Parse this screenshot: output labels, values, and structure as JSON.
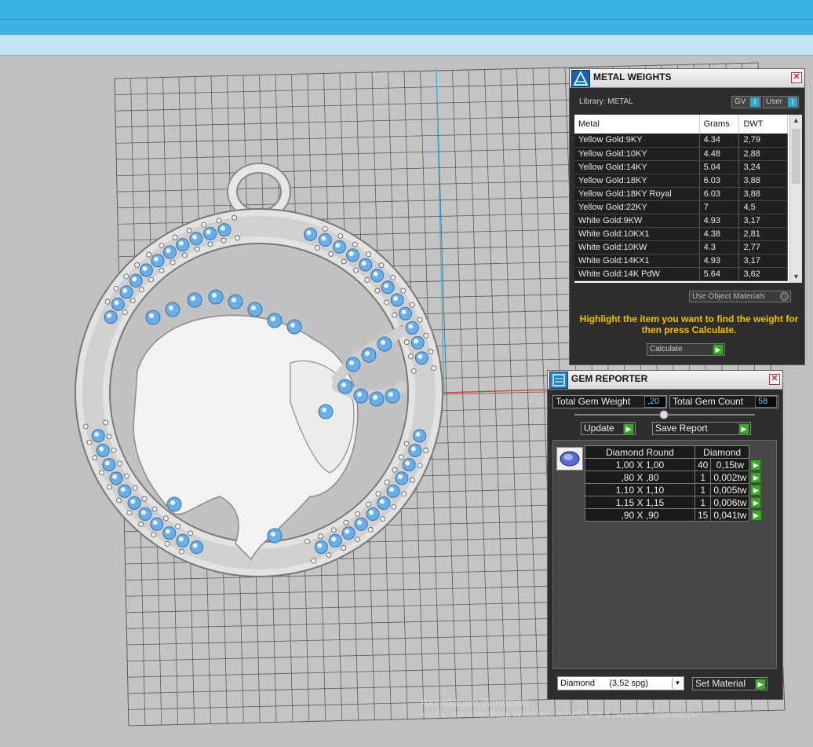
{
  "metal_weights": {
    "title": "METAL WEIGHTS",
    "library_label": "Library: METAL",
    "toggle_gv": "GV",
    "toggle_user": "User",
    "columns": [
      "Metal",
      "Grams",
      "DWT"
    ],
    "rows": [
      [
        "Yellow Gold:9KY",
        "4.34",
        "2,79"
      ],
      [
        "Yellow Gold:10KY",
        "4.48",
        "2,88"
      ],
      [
        "Yellow Gold:14KY",
        "5.04",
        "3,24"
      ],
      [
        "Yellow Gold:18KY",
        "6.03",
        "3,88"
      ],
      [
        "Yellow Gold:18KY Royal",
        "6.03",
        "3,88"
      ],
      [
        "Yellow Gold:22KY",
        "7",
        "4,5"
      ],
      [
        "White Gold:9KW",
        "4.93",
        "3,17"
      ],
      [
        "White Gold:10KX1",
        "4.38",
        "2,81"
      ],
      [
        "White Gold:10KW",
        "4.3",
        "2,77"
      ],
      [
        "White Gold:14KX1",
        "4.93",
        "3,17"
      ],
      [
        "White Gold:14K PdW",
        "5.64",
        "3,62"
      ]
    ],
    "use_object_materials": "Use Object Materials",
    "hint": "Highlight the item you want to find the weight for then press Calculate.",
    "calculate_label": "Calculate"
  },
  "gem_reporter": {
    "title": "GEM REPORTER",
    "total_weight_label": "Total Gem Weight",
    "total_weight_value": ",20",
    "total_count_label": "Total Gem Count",
    "total_count_value": "58",
    "update_label": "Update",
    "save_report_label": "Save Report",
    "table_headers": [
      "Diamond Round",
      "Diamond"
    ],
    "rows": [
      [
        "1,00 X 1,00",
        "40",
        "0,15tw"
      ],
      [
        ",80 X ,80",
        "1",
        "0,002tw"
      ],
      [
        "1,10 X 1,10",
        "1",
        "0,005tw"
      ],
      [
        "1,15 X 1,15",
        "1",
        "0,006tw"
      ],
      [
        ",90 X ,90",
        "15",
        "0,041tw"
      ]
    ],
    "material_select": "Diamond      (3,52 spg)",
    "set_material_label": "Set Material"
  },
  "watermark": {
    "line1": "Активация Windows",
    "line2": "Чтобы активировать Windows, перейдите в раздел \"Параметры\"."
  },
  "colors": {
    "titlebar_blue": "#3cb3e3",
    "hint_yellow": "#f2c000",
    "gem_blue": "#6aaee8",
    "green_button": "#3fa52c"
  }
}
